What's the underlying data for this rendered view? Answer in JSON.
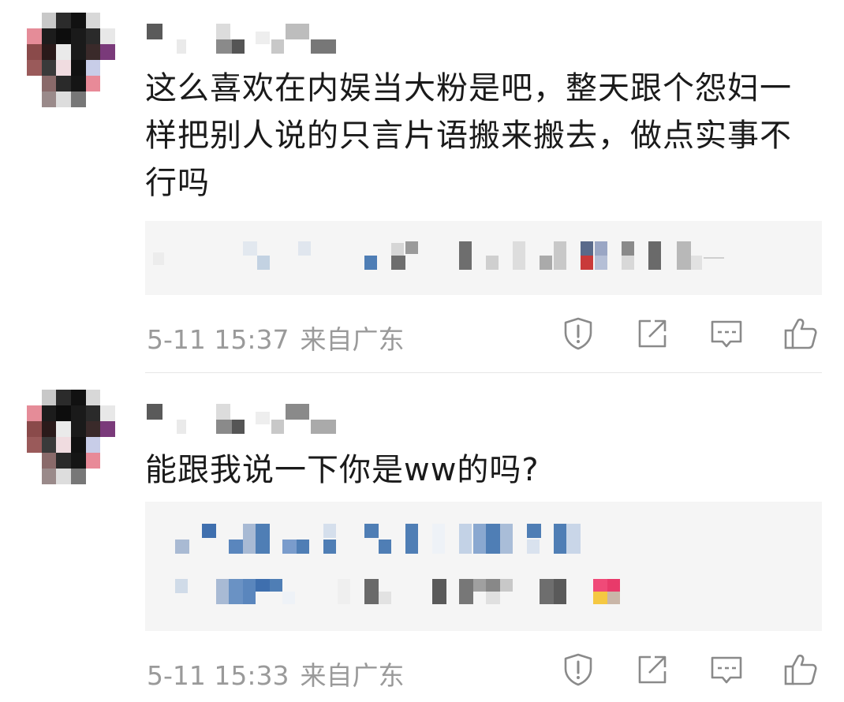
{
  "comments": [
    {
      "text": "这么喜欢在内娱当大粉是吧，整天跟个怨妇一样把别人说的只言片语搬来搬去，做点实事不行吗",
      "time": "5-11 15:37",
      "location": "来自广东"
    },
    {
      "text": "能跟我说一下你是ww的吗?",
      "time": "5-11 15:33",
      "location": "来自广东"
    }
  ],
  "icons": [
    "report-icon",
    "share-icon",
    "reply-icon",
    "like-icon"
  ],
  "colors": {
    "text": "#1a1a1a",
    "meta": "#9a9a9a",
    "icon": "#8a8a8a",
    "quote_bg": "#f5f5f5",
    "divider": "#e6e6e6"
  }
}
